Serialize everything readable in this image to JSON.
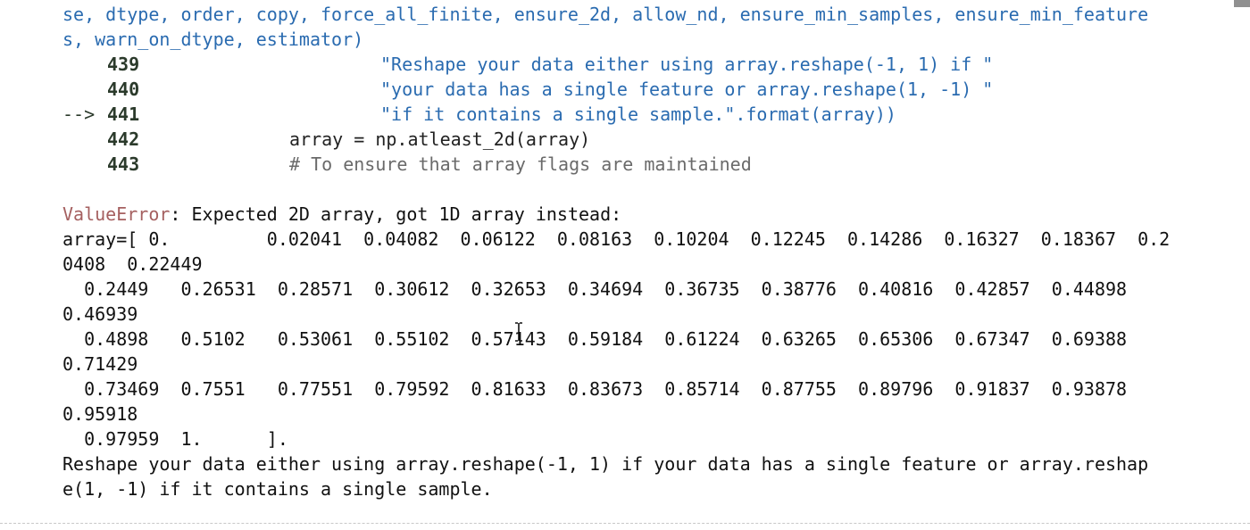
{
  "traceback": {
    "sig_line1": "se, dtype, order, copy, force_all_finite, ensure_2d, allow_nd, ensure_min_samples, ensure_min_feature",
    "sig_line2": "s, warn_on_dtype, estimator)",
    "lines": [
      {
        "marker": "",
        "number": "439",
        "code": "\"Reshape your data either using array.reshape(-1, 1) if \""
      },
      {
        "marker": "",
        "number": "440",
        "code": "\"your data has a single feature or array.reshape(1, -1) \""
      },
      {
        "marker": "-->",
        "number": "441",
        "code": "\"if it contains a single sample.\".format(array))"
      },
      {
        "marker": "",
        "number": "442",
        "code": "array = np.atleast_2d(array)"
      },
      {
        "marker": "",
        "number": "443",
        "code": "# To ensure that array flags are maintained"
      }
    ]
  },
  "error": {
    "type": "ValueError",
    "message": ": Expected 2D array, got 1D array instead:",
    "array_lines": [
      "array=[ 0.         0.02041  0.04082  0.06122  0.08163  0.10204  0.12245  0.14286  0.16327  0.18367  0.2",
      "0408  0.22449",
      "  0.2449   0.26531  0.28571  0.30612  0.32653  0.34694  0.36735  0.38776  0.40816  0.42857  0.44898",
      "0.46939",
      "  0.4898   0.5102   0.53061  0.55102  0.57143  0.59184  0.61224  0.63265  0.65306  0.67347  0.69388",
      "0.71429",
      "  0.73469  0.7551   0.77551  0.79592  0.81633  0.83673  0.85714  0.87755  0.89796  0.91837  0.93878",
      "0.95918",
      "  0.97959  1.      ]."
    ],
    "hint_line1": "Reshape your data either using array.reshape(-1, 1) if your data has a single feature or array.reshap",
    "hint_line2": "e(1, -1) if it contains a single sample."
  },
  "cursor_icon": "text-cursor-icon"
}
